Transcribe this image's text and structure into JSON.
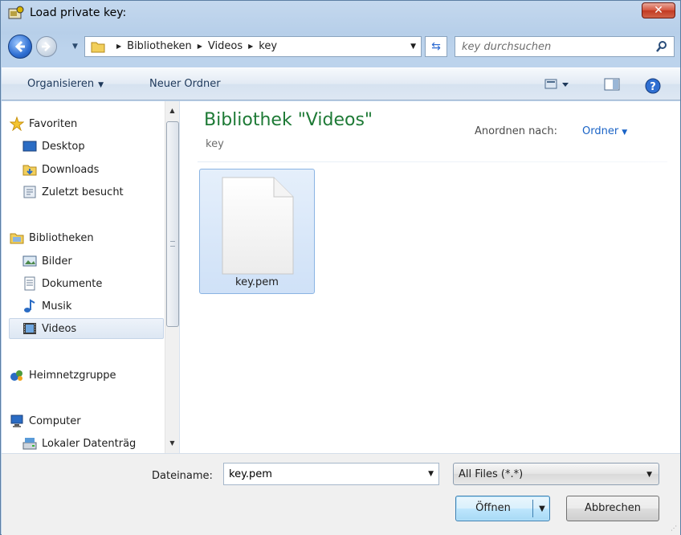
{
  "window": {
    "title": "Load private key:",
    "close_label": "✕"
  },
  "address": {
    "crumbs": [
      "Bibliotheken",
      "Videos",
      "key"
    ],
    "search_placeholder": "key durchsuchen"
  },
  "toolbar": {
    "organize": "Organisieren",
    "new_folder": "Neuer Ordner"
  },
  "sidebar": {
    "favorites": {
      "label": "Favoriten",
      "items": [
        "Desktop",
        "Downloads",
        "Zuletzt besucht"
      ]
    },
    "libraries": {
      "label": "Bibliotheken",
      "items": [
        "Bilder",
        "Dokumente",
        "Musik",
        "Videos"
      ],
      "selected": "Videos"
    },
    "homegroup": "Heimnetzgruppe",
    "computer": {
      "label": "Computer",
      "items": [
        "Lokaler Datenträg"
      ]
    }
  },
  "main": {
    "library_title": "Bibliothek \"Videos\"",
    "subtitle": "key",
    "arrange_label": "Anordnen nach:",
    "arrange_value": "Ordner",
    "files": [
      {
        "name": "key.pem",
        "selected": true
      }
    ]
  },
  "footer": {
    "filename_label": "Dateiname:",
    "filename_value": "key.pem",
    "filter_value": "All Files (*.*)",
    "open_label": "Öffnen",
    "cancel_label": "Abbrechen"
  },
  "colors": {
    "library_title": "#1e7a36",
    "link": "#1a63c6",
    "selection": "#cfe1f7"
  }
}
